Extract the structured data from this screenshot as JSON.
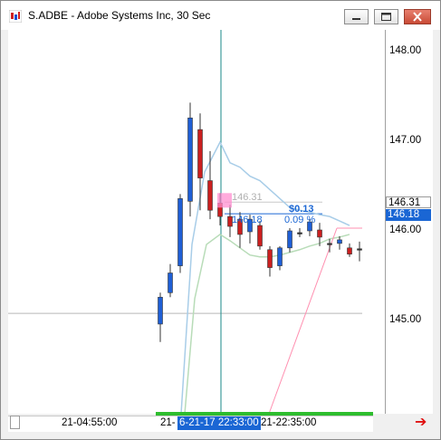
{
  "window": {
    "title": "S.ADBE - Adobe Systems Inc, 30 Sec",
    "app_icon": "chart-app-icon",
    "buttons": [
      "minimize-icon",
      "maximize-icon",
      "close-icon"
    ]
  },
  "axis": {
    "y_ticks": [
      "148.00",
      "147.00",
      "146.00",
      "145.00"
    ],
    "x_labels": [
      "21-04:55:00",
      "21-",
      "6-21-17 22:33:00",
      "21-22:35:00"
    ],
    "last_price_label": "146.18",
    "crosshair_price_label": "146.31"
  },
  "annotations": {
    "level_label": "146.31",
    "price_label": "146.18",
    "change_value": "$0.13",
    "change_percent": "0.09 %"
  },
  "colors": {
    "up": "#1f5fd6",
    "down": "#cc1f1f",
    "upper_band": "#a8cde8",
    "lower_band": "#b8dcb8",
    "trend_line": "#ff8fb0",
    "crosshair": "#1a8a8a",
    "accent": "#1a66d4"
  },
  "chart_data": {
    "type": "candlestick",
    "title": "S.ADBE - Adobe Systems Inc, 30 Sec",
    "ylim": [
      144.0,
      148.4
    ],
    "y_ticks": [
      148.0,
      147.0,
      146.0,
      145.0
    ],
    "candles": [
      {
        "open": 144.95,
        "close": 145.25,
        "high": 145.3,
        "low": 144.75
      },
      {
        "open": 145.3,
        "close": 145.52,
        "high": 145.62,
        "low": 145.25
      },
      {
        "open": 145.6,
        "close": 146.35,
        "high": 146.4,
        "low": 145.52
      },
      {
        "open": 146.32,
        "close": 147.25,
        "high": 147.42,
        "low": 146.15
      },
      {
        "open": 147.12,
        "close": 146.58,
        "high": 147.3,
        "low": 146.22
      },
      {
        "open": 146.55,
        "close": 146.22,
        "high": 146.88,
        "low": 146.12
      },
      {
        "open": 146.3,
        "close": 146.15,
        "high": 146.41,
        "low": 146.05
      },
      {
        "open": 146.15,
        "close": 146.04,
        "high": 146.28,
        "low": 145.92
      },
      {
        "open": 146.12,
        "close": 145.95,
        "high": 146.2,
        "low": 145.8
      },
      {
        "open": 145.98,
        "close": 146.12,
        "high": 146.17,
        "low": 145.85
      },
      {
        "open": 146.05,
        "close": 145.82,
        "high": 146.1,
        "low": 145.78
      },
      {
        "open": 145.78,
        "close": 145.58,
        "high": 145.82,
        "low": 145.48
      },
      {
        "open": 145.6,
        "close": 145.8,
        "high": 145.82,
        "low": 145.55
      },
      {
        "open": 145.8,
        "close": 145.99,
        "high": 146.02,
        "low": 145.75
      },
      {
        "open": 145.97,
        "close": 145.97,
        "high": 146.02,
        "low": 145.92
      },
      {
        "open": 145.99,
        "close": 146.09,
        "high": 146.12,
        "low": 145.93
      },
      {
        "open": 146.0,
        "close": 145.92,
        "high": 146.08,
        "low": 145.82
      },
      {
        "open": 145.85,
        "close": 145.85,
        "high": 145.9,
        "low": 145.75
      },
      {
        "open": 145.85,
        "close": 145.89,
        "high": 145.93,
        "low": 145.78
      },
      {
        "open": 145.8,
        "close": 145.73,
        "high": 145.85,
        "low": 145.7
      },
      {
        "open": 145.79,
        "close": 145.79,
        "high": 145.87,
        "low": 145.65
      }
    ],
    "upper_band": [
      146.98,
      146.75,
      146.7,
      146.6,
      146.55,
      146.45,
      146.35,
      146.25,
      146.22,
      146.2,
      146.17,
      146.15,
      146.1,
      146.05
    ],
    "lower_band": [
      145.95,
      145.88,
      145.8,
      145.72,
      145.7,
      145.7,
      145.72,
      145.75,
      145.78,
      145.82,
      145.85,
      145.9,
      145.92,
      145.95
    ],
    "horizontal_line": 145.07,
    "level_line": 146.31,
    "crosshair_price": 146.18,
    "change": "$0.13",
    "change_percent": "0.09 %"
  }
}
